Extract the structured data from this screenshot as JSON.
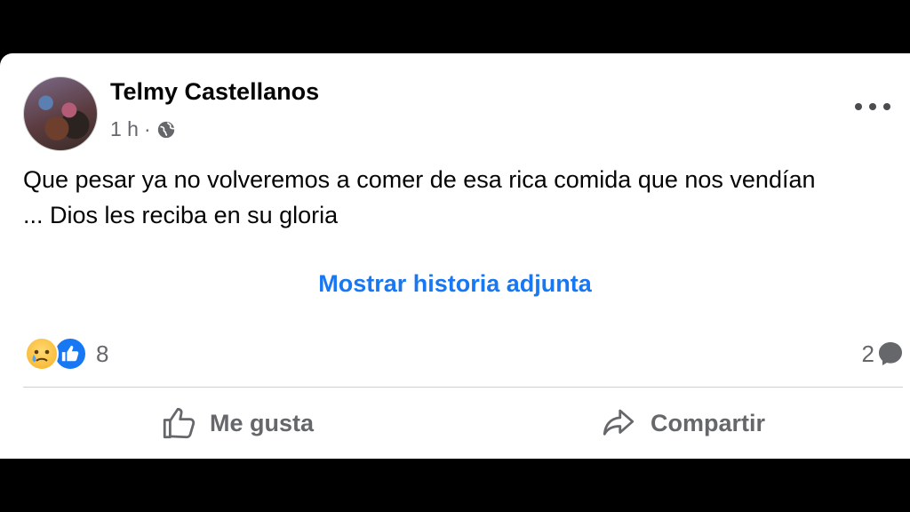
{
  "post": {
    "author": "Telmy Castellanos",
    "time": "1 h",
    "separator": "·",
    "audience_icon": "globe-icon",
    "text_line1": "Que pesar ya no volveremos a comer de esa rica comida que nos vendían",
    "text_line2": "... Dios les reciba en su gloria",
    "attachment_link": "Mostrar historia adjunta"
  },
  "reactions": {
    "icons": [
      "sad-reaction-icon",
      "like-reaction-icon"
    ],
    "count": "8"
  },
  "comments": {
    "count": "2",
    "icon": "comment-icon"
  },
  "actions": {
    "like_label": "Me gusta",
    "share_label": "Compartir"
  },
  "colors": {
    "link": "#1877f2",
    "secondary_text": "#65676b",
    "primary_text": "#050505"
  }
}
